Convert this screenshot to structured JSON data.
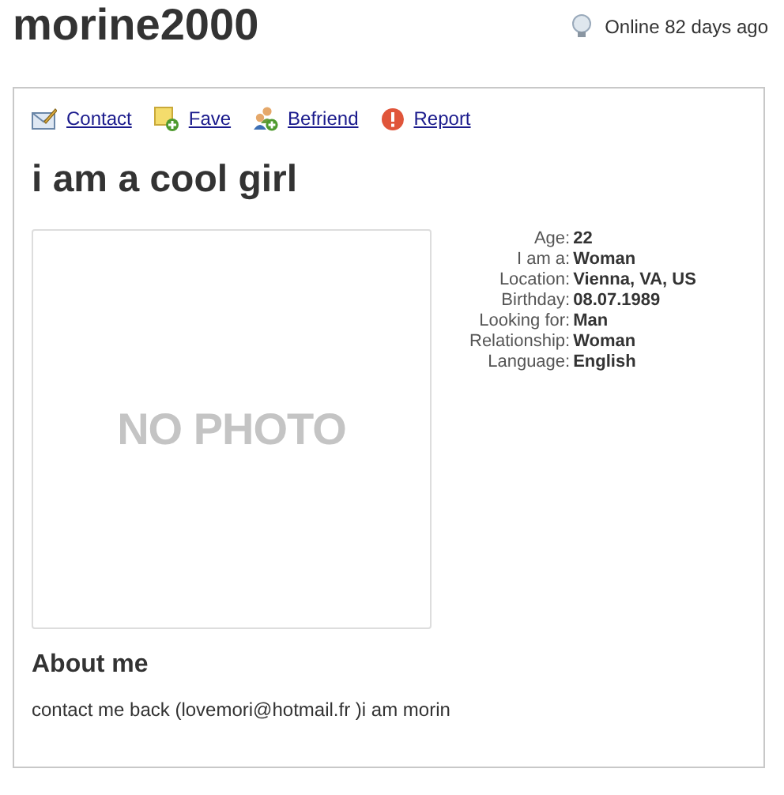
{
  "profile": {
    "username": "morine2000",
    "status": "Online 82 days ago"
  },
  "actions": [
    {
      "kind": "contact",
      "label": "Contact"
    },
    {
      "kind": "fave",
      "label": "Fave"
    },
    {
      "kind": "befriend",
      "label": "Befriend"
    },
    {
      "kind": "report",
      "label": "Report"
    }
  ],
  "headline": "i am a cool girl",
  "photo_placeholder": "NO PHOTO",
  "details": [
    {
      "label": "Age:",
      "value": "22"
    },
    {
      "label": "I am a:",
      "value": "Woman"
    },
    {
      "label": "Location:",
      "value": "Vienna, VA, US"
    },
    {
      "label": "Birthday:",
      "value": "08.07.1989"
    },
    {
      "label": "Looking for:",
      "value": "Man"
    },
    {
      "label": "Relationship:",
      "value": "Woman"
    },
    {
      "label": "Language:",
      "value": "English"
    }
  ],
  "about": {
    "heading": "About me",
    "text": "contact me back (lovemori@hotmail.fr )i am morin"
  }
}
